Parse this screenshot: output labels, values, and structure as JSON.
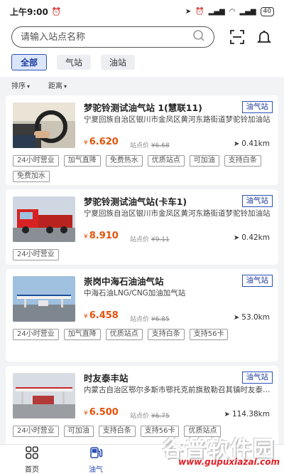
{
  "status": {
    "time": "上午9:00",
    "battery": "40"
  },
  "search": {
    "placeholder": "请输入站点名称"
  },
  "filters": [
    {
      "label": "全部"
    },
    {
      "label": "气站"
    },
    {
      "label": "油站"
    }
  ],
  "sort": {
    "sort_label": "排序",
    "distance_label": "距离"
  },
  "stations": [
    {
      "name": "梦驼铃测试油气站 1(慧联11)",
      "badge": "油气站",
      "address": "宁夏回族自治区银川市金凤区黄河东路街道梦驼铃加油站",
      "price": "6.620",
      "list_label": "站点价",
      "list_price": "6.68",
      "distance": "0.41km",
      "tags": [
        "24小时营业",
        "加气直降",
        "免费热水",
        "优质站点",
        "可加油",
        "支持白条",
        "免费加水"
      ]
    },
    {
      "name": "梦驼铃测试油气站(卡车1)",
      "badge": "油气站",
      "address": "宁夏回族自治区银川市金凤区黄河东路街道梦驼铃加油站",
      "price": "8.910",
      "list_label": "站点价",
      "list_price": "9.11",
      "distance": "0.42km",
      "tags": [
        "24小时营业"
      ]
    },
    {
      "name": "崇岗中海石油油气站",
      "badge": "油气站",
      "address": "中海石油LNG/CNG加油加气站",
      "price": "6.458",
      "list_label": "站点价",
      "list_price": "6.85",
      "distance": "53.0km",
      "tags": [
        "24小时营业",
        "加气直降",
        "优质站点",
        "支持白条",
        "支持56卡"
      ]
    },
    {
      "name": "时友泰丰站",
      "badge": "油气站",
      "address": "内蒙古自治区鄂尔多斯市鄂托克前旗敖勒召其镇时友泰丰站",
      "price": "6.500",
      "list_label": "站点价",
      "list_price": "6.75",
      "distance": "114.38km",
      "tags": [
        "24小时营业",
        "可加油",
        "支持白条",
        "支持56卡",
        "优质站点"
      ]
    }
  ],
  "tabbar": [
    {
      "label": "首页"
    },
    {
      "label": "油气"
    }
  ],
  "watermark": {
    "brand": "谷普软件园",
    "url": "www.gupuxiazai.com"
  },
  "colors": {
    "accent": "#2b4fb5",
    "price": "#e4520b",
    "background": "#f2f3f5"
  }
}
